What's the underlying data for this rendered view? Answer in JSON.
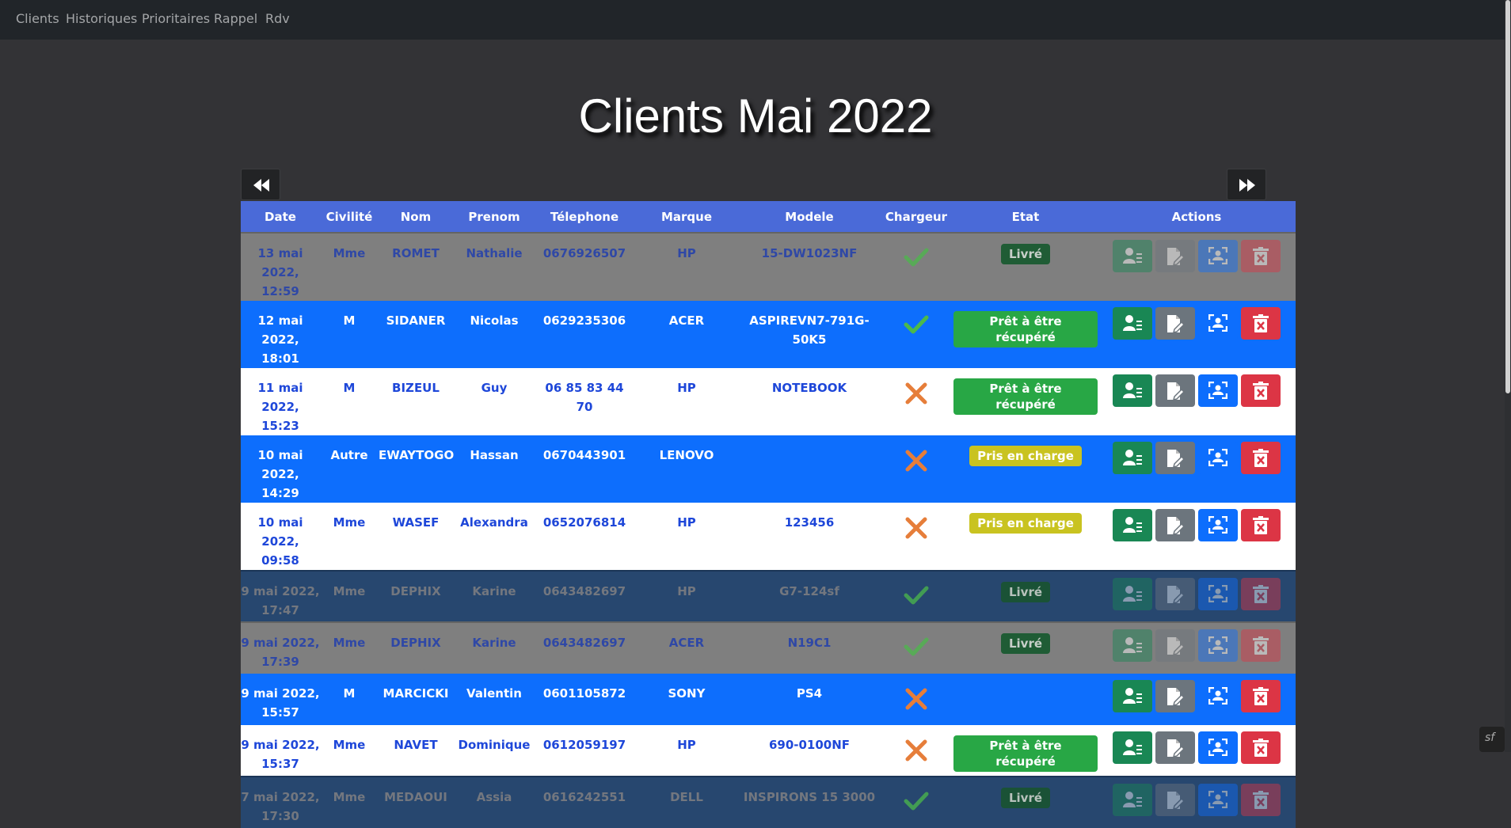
{
  "nav": {
    "items": [
      {
        "label": "Clients"
      },
      {
        "label": "Historiques"
      },
      {
        "label": "Prioritaires"
      },
      {
        "label": "Rappel"
      },
      {
        "label": "Rdv"
      }
    ]
  },
  "page": {
    "title": "Clients Mai 2022"
  },
  "pager": {
    "prev_icon": "fast-backward-icon",
    "next_icon": "fast-forward-icon"
  },
  "table": {
    "headers": {
      "date": "Date",
      "civilite": "Civilité",
      "nom": "Nom",
      "prenom": "Prenom",
      "telephone": "Télephone",
      "marque": "Marque",
      "modele": "Modele",
      "chargeur": "Chargeur",
      "etat": "Etat",
      "actions": "Actions"
    },
    "rows": [
      {
        "style": "grey",
        "date_l1": "13 mai",
        "date_l2": "2022, 12:59",
        "civilite": "Mme",
        "nom": "ROMET",
        "prenom": "Nathalie",
        "telephone": "0676926507",
        "marque": "HP",
        "modele": "15-DW1023NF",
        "chargeur": true,
        "etat": "Livré"
      },
      {
        "style": "blue",
        "date_l1": "12 mai",
        "date_l2": "2022, 18:01",
        "civilite": "M",
        "nom": "SIDANER",
        "prenom": "Nicolas",
        "telephone": "0629235306",
        "marque": "ACER",
        "modele": "ASPIREVN7-791G-50K5",
        "chargeur": true,
        "etat": "Prêt à être récupéré"
      },
      {
        "style": "white",
        "date_l1": "11 mai",
        "date_l2": "2022, 15:23",
        "civilite": "M",
        "nom": "BIZEUL",
        "prenom": "Guy",
        "telephone": "06 85 83 44 70",
        "marque": "HP",
        "modele": "NOTEBOOK",
        "chargeur": false,
        "etat": "Prêt à être récupéré"
      },
      {
        "style": "blue",
        "date_l1": "10 mai",
        "date_l2": "2022, 14:29",
        "civilite": "Autre",
        "nom": "EWAYTOGO",
        "prenom": "Hassan",
        "telephone": "0670443901",
        "marque": "LENOVO",
        "modele": "",
        "chargeur": false,
        "etat": "Pris en charge"
      },
      {
        "style": "white",
        "date_l1": "10 mai",
        "date_l2": "2022, 09:58",
        "civilite": "Mme",
        "nom": "WASEF",
        "prenom": "Alexandra",
        "telephone": "0652076814",
        "marque": "HP",
        "modele": "123456",
        "chargeur": false,
        "etat": "Pris en charge"
      },
      {
        "style": "navy",
        "date_l1": "9 mai 2022,",
        "date_l2": "17:47",
        "civilite": "Mme",
        "nom": "DEPHIX",
        "prenom": "Karine",
        "telephone": "0643482697",
        "marque": "HP",
        "modele": "G7-124sf",
        "chargeur": true,
        "etat": "Livré"
      },
      {
        "style": "grey",
        "date_l1": "9 mai 2022,",
        "date_l2": "17:39",
        "civilite": "Mme",
        "nom": "DEPHIX",
        "prenom": "Karine",
        "telephone": "0643482697",
        "marque": "ACER",
        "modele": "N19C1",
        "chargeur": true,
        "etat": "Livré"
      },
      {
        "style": "blue",
        "date_l1": "9 mai 2022,",
        "date_l2": "15:57",
        "civilite": "M",
        "nom": "MARCICKI",
        "prenom": "Valentin",
        "telephone": "0601105872",
        "marque": "SONY",
        "modele": "PS4",
        "chargeur": false,
        "etat": ""
      },
      {
        "style": "white",
        "date_l1": "9 mai 2022,",
        "date_l2": "15:37",
        "civilite": "Mme",
        "nom": "NAVET",
        "prenom": "Dominique",
        "telephone": "0612059197",
        "marque": "HP",
        "modele": "690-0100NF",
        "chargeur": false,
        "etat": "Prêt à être récupéré"
      },
      {
        "style": "navy",
        "date_l1": "7 mai 2022,",
        "date_l2": "17:30",
        "civilite": "Mme",
        "nom": "MEDAOUI",
        "prenom": "Assia",
        "telephone": "0616242551",
        "marque": "DELL",
        "modele": "INSPIRONS 15 3000",
        "chargeur": true,
        "etat": "Livré"
      }
    ]
  },
  "colors": {
    "header_bg": "#4a6ad8",
    "row_blue": "#0d6efd",
    "row_grey": "#7f7f7f",
    "row_navy": "#27476f",
    "badge_livre": "#1e6e3d",
    "badge_pret": "#28a745",
    "badge_pris": "#c9c320",
    "check_green": "#4cb94a",
    "cross_orange": "#e67e3a"
  },
  "icons": {
    "check": "check-icon",
    "cross": "cross-icon",
    "view": "user-details-icon",
    "edit": "edit-document-icon",
    "scan": "scan-user-icon",
    "delete": "delete-icon",
    "framework": "symfony-icon"
  },
  "framework_badge": "sf"
}
